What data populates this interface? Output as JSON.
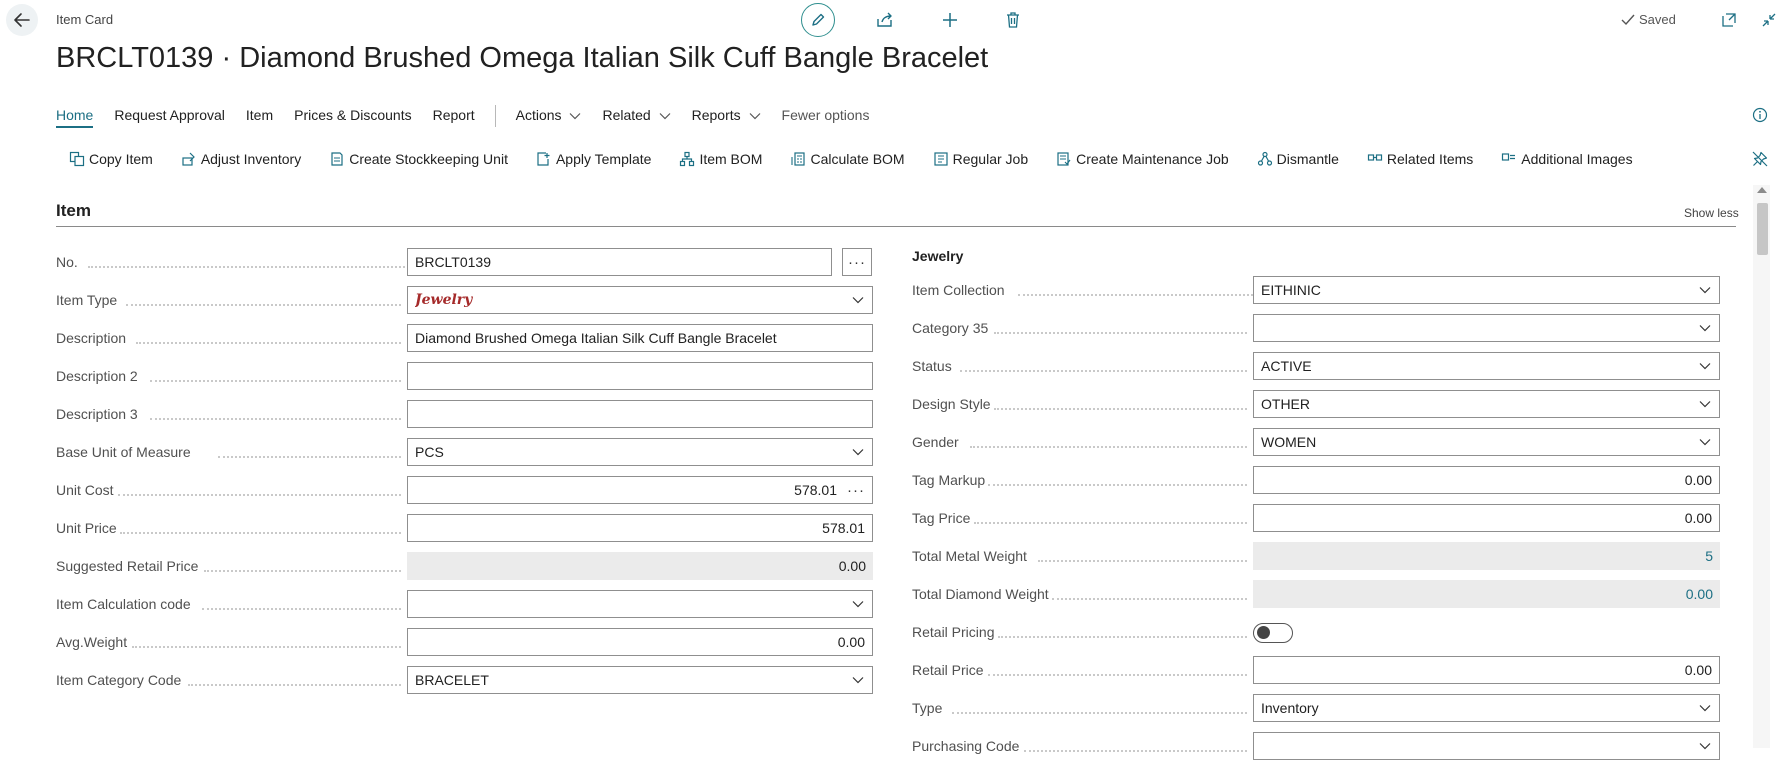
{
  "header": {
    "page_label": "Item Card",
    "saved_label": "Saved",
    "title": "BRCLT0139 · Diamond Brushed Omega Italian Silk Cuff Bangle Bracelet"
  },
  "tabs": [
    {
      "label": "Home",
      "active": true
    },
    {
      "label": "Request Approval"
    },
    {
      "label": "Item"
    },
    {
      "label": "Prices & Discounts"
    },
    {
      "label": "Report"
    }
  ],
  "menus": [
    {
      "label": "Actions"
    },
    {
      "label": "Related"
    },
    {
      "label": "Reports"
    }
  ],
  "fewer_options": "Fewer options",
  "actions": [
    {
      "label": "Copy Item",
      "icon": "copy-icon"
    },
    {
      "label": "Adjust Inventory",
      "icon": "adjust-inventory-icon"
    },
    {
      "label": "Create Stockkeeping Unit",
      "icon": "stockkeeping-icon"
    },
    {
      "label": "Apply Template",
      "icon": "template-icon"
    },
    {
      "label": "Item BOM",
      "icon": "hierarchy-icon"
    },
    {
      "label": "Calculate BOM",
      "icon": "calculate-icon"
    },
    {
      "label": "Regular Job",
      "icon": "job-icon"
    },
    {
      "label": "Create Maintenance Job",
      "icon": "maintenance-icon"
    },
    {
      "label": "Dismantle",
      "icon": "dismantle-icon"
    },
    {
      "label": "Related Items",
      "icon": "related-icon"
    },
    {
      "label": "Additional Images",
      "icon": "images-icon"
    }
  ],
  "section": {
    "title": "Item",
    "show_less": "Show less"
  },
  "left_fields": {
    "no": {
      "label": "No.",
      "value": "BRCLT0139"
    },
    "item_type": {
      "label": "Item Type",
      "value": "Jewelry"
    },
    "description": {
      "label": "Description",
      "value": "Diamond Brushed Omega Italian Silk Cuff Bangle Bracelet"
    },
    "description2": {
      "label": "Description 2",
      "value": ""
    },
    "description3": {
      "label": "Description 3",
      "value": ""
    },
    "base_uom": {
      "label": "Base Unit of Measure",
      "value": "PCS"
    },
    "unit_cost": {
      "label": "Unit Cost",
      "value": "578.01"
    },
    "unit_price": {
      "label": "Unit Price",
      "value": "578.01"
    },
    "suggested_retail": {
      "label": "Suggested Retail Price",
      "value": "0.00"
    },
    "item_calc_code": {
      "label": "Item Calculation code",
      "value": ""
    },
    "avg_weight": {
      "label": "Avg.Weight",
      "value": "0.00"
    },
    "item_category": {
      "label": "Item Category Code",
      "value": "BRACELET"
    }
  },
  "right_group": "Jewelry",
  "right_fields": {
    "item_collection": {
      "label": "Item Collection",
      "value": "EITHINIC"
    },
    "category35": {
      "label": "Category 35",
      "value": ""
    },
    "status": {
      "label": "Status",
      "value": "ACTIVE"
    },
    "design_style": {
      "label": "Design Style",
      "value": "OTHER"
    },
    "gender": {
      "label": "Gender",
      "value": "WOMEN"
    },
    "tag_markup": {
      "label": "Tag Markup",
      "value": "0.00"
    },
    "tag_price": {
      "label": "Tag Price",
      "value": "0.00"
    },
    "total_metal_weight": {
      "label": "Total Metal Weight",
      "value": "5"
    },
    "total_diamond_weight": {
      "label": "Total Diamond Weight",
      "value": "0.00"
    },
    "retail_pricing": {
      "label": "Retail Pricing",
      "value": false
    },
    "retail_price": {
      "label": "Retail Price",
      "value": "0.00"
    },
    "type": {
      "label": "Type",
      "value": "Inventory"
    },
    "purchasing_code": {
      "label": "Purchasing Code",
      "value": ""
    }
  },
  "colors": {
    "accent": "#1c6f84",
    "jewelry": "#a52a2a",
    "readonly_bg": "#ebebeb"
  }
}
